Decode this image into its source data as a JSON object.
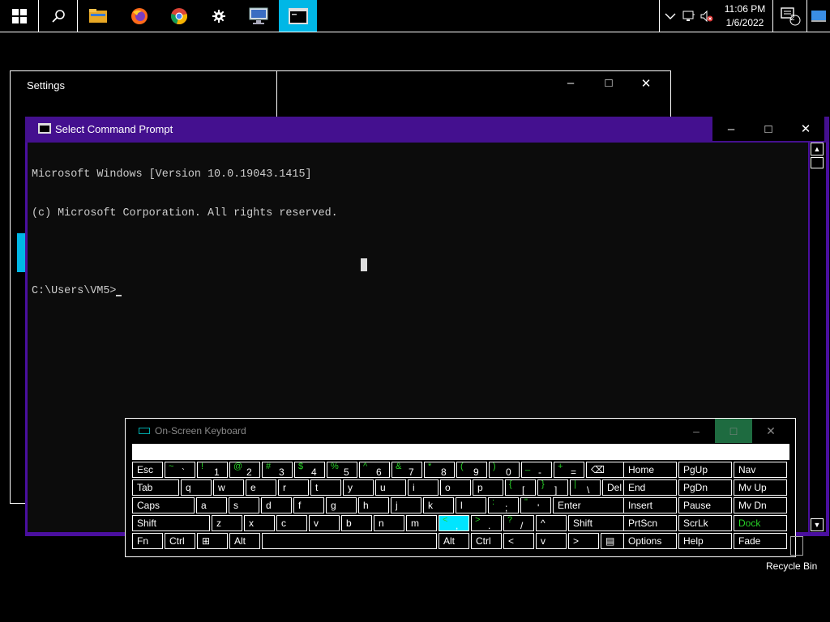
{
  "taskbar": {
    "clock_time": "11:06 PM",
    "clock_date": "1/6/2022",
    "notification_count": "2",
    "apps": [
      {
        "name": "start-button",
        "icon": "windows-logo-icon"
      },
      {
        "name": "search-button",
        "icon": "search-icon"
      },
      {
        "name": "file-explorer-button",
        "icon": "folder-icon"
      },
      {
        "name": "firefox-button",
        "icon": "firefox-icon"
      },
      {
        "name": "chrome-button",
        "icon": "chrome-icon"
      },
      {
        "name": "settings-button",
        "icon": "gear-icon"
      },
      {
        "name": "remote-desktop-button",
        "icon": "remote-desktop-icon"
      },
      {
        "name": "command-prompt-button",
        "icon": "cmd-icon",
        "active": true
      }
    ]
  },
  "settings_window": {
    "title": "Settings"
  },
  "cmd_window": {
    "title": "Select Command Prompt",
    "lines": [
      "Microsoft Windows [Version 10.0.19043.1415]",
      "(c) Microsoft Corporation. All rights reserved.",
      "",
      "C:\\Users\\VM5>"
    ]
  },
  "osk": {
    "title": "On-Screen Keyboard",
    "rows": [
      [
        {
          "main": "Esc"
        },
        {
          "shift": "~",
          "main": "`"
        },
        {
          "shift": "!",
          "main": "1"
        },
        {
          "shift": "@",
          "main": "2"
        },
        {
          "shift": "#",
          "main": "3"
        },
        {
          "shift": "$",
          "main": "4"
        },
        {
          "shift": "%",
          "main": "5"
        },
        {
          "shift": "^",
          "main": "6"
        },
        {
          "shift": "&",
          "main": "7"
        },
        {
          "shift": "*",
          "main": "8"
        },
        {
          "shift": "(",
          "main": "9"
        },
        {
          "shift": ")",
          "main": "0"
        },
        {
          "shift": "_",
          "main": "-"
        },
        {
          "shift": "+",
          "main": "="
        },
        {
          "main": "⌫"
        }
      ],
      [
        {
          "main": "Tab"
        },
        {
          "main": "q"
        },
        {
          "main": "w"
        },
        {
          "main": "e"
        },
        {
          "main": "r"
        },
        {
          "main": "t"
        },
        {
          "main": "y"
        },
        {
          "main": "u"
        },
        {
          "main": "i"
        },
        {
          "main": "o"
        },
        {
          "main": "p"
        },
        {
          "shift": "{",
          "main": "["
        },
        {
          "shift": "}",
          "main": "]"
        },
        {
          "shift": "|",
          "main": "\\"
        },
        {
          "main": "Del"
        }
      ],
      [
        {
          "main": "Caps"
        },
        {
          "main": "a"
        },
        {
          "main": "s"
        },
        {
          "main": "d"
        },
        {
          "main": "f"
        },
        {
          "main": "g"
        },
        {
          "main": "h"
        },
        {
          "main": "j"
        },
        {
          "main": "k"
        },
        {
          "main": "l"
        },
        {
          "shift": ":",
          "main": ";"
        },
        {
          "shift": "\"",
          "main": "'"
        },
        {
          "main": "Enter"
        }
      ],
      [
        {
          "main": "Shift"
        },
        {
          "main": "z"
        },
        {
          "main": "x"
        },
        {
          "main": "c"
        },
        {
          "main": "v"
        },
        {
          "main": "b"
        },
        {
          "main": "n"
        },
        {
          "main": "m"
        },
        {
          "shift": "<",
          "main": ","
        },
        {
          "shift": ">",
          "main": "."
        },
        {
          "shift": "?",
          "main": "/"
        },
        {
          "main": "^"
        },
        {
          "main": "Shift"
        }
      ],
      [
        {
          "main": "Fn"
        },
        {
          "main": "Ctrl"
        },
        {
          "main": "⊞"
        },
        {
          "main": "Alt"
        },
        {
          "main": ""
        },
        {
          "main": "Alt"
        },
        {
          "main": "Ctrl"
        },
        {
          "main": "<"
        },
        {
          "main": "v"
        },
        {
          "main": ">"
        },
        {
          "main": "▤"
        }
      ]
    ],
    "nav_keys": [
      [
        "Home",
        "PgUp",
        "Nav"
      ],
      [
        "End",
        "PgDn",
        "Mv Up"
      ],
      [
        "Insert",
        "Pause",
        "Mv Dn"
      ],
      [
        "PrtScn",
        "ScrLk",
        "Dock"
      ],
      [
        "Options",
        "Help",
        "Fade"
      ]
    ]
  },
  "desktop": {
    "recycle_bin_label": "Recycle Bin"
  }
}
